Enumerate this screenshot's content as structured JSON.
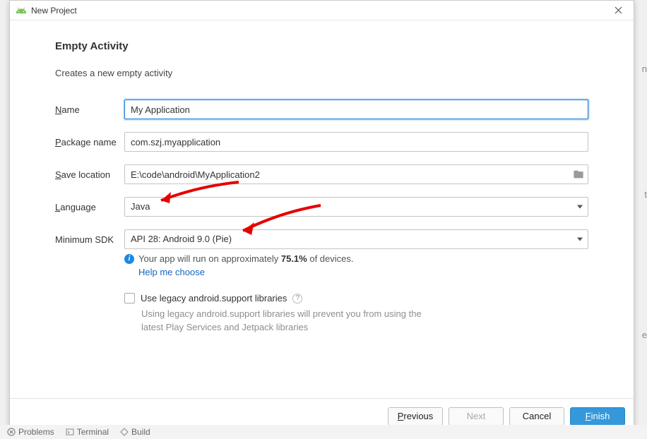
{
  "window": {
    "title": "New Project"
  },
  "heading": "Empty Activity",
  "sub_desc": "Creates a new empty activity",
  "labels": {
    "name": "Name",
    "package": "Package name",
    "location": "Save location",
    "language": "Language",
    "minsdk": "Minimum SDK"
  },
  "fields": {
    "name": "My Application",
    "package": "com.szj.myapplication",
    "location": "E:\\code\\android\\MyApplication2",
    "language": "Java",
    "minsdk": "API 28: Android 9.0 (Pie)"
  },
  "info": {
    "prefix": "Your app will run on approximately ",
    "percent": "75.1%",
    "suffix": " of devices.",
    "help_link": "Help me choose"
  },
  "legacy": {
    "checkbox_label": "Use legacy android.support libraries",
    "hint": "Using legacy android.support libraries will prevent you from using the latest Play Services and Jetpack libraries"
  },
  "buttons": {
    "previous": "Previous",
    "next": "Next",
    "cancel": "Cancel",
    "finish": "Finish"
  },
  "status": {
    "problems": "Problems",
    "terminal": "Terminal",
    "build": "Build"
  }
}
